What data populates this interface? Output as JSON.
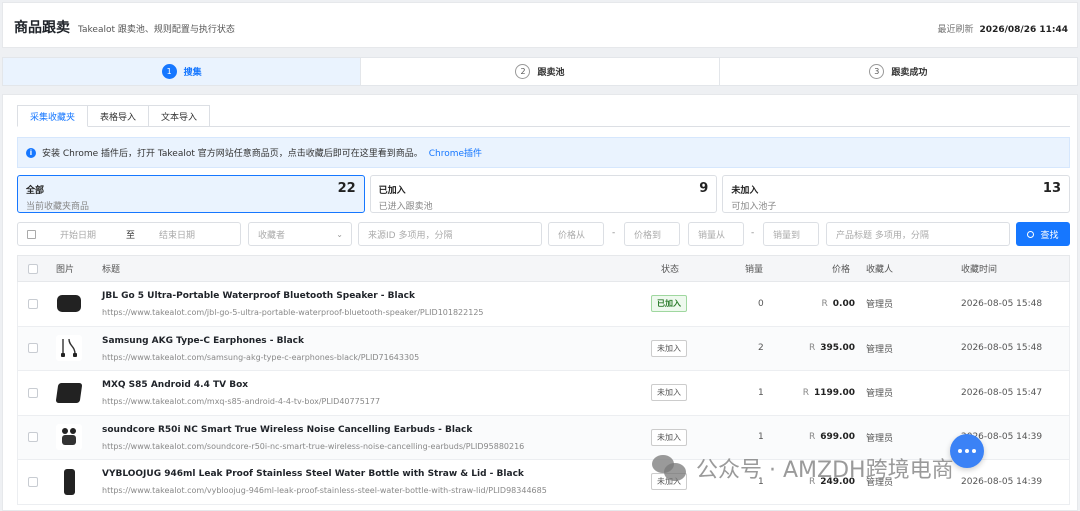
{
  "header": {
    "title": "商品跟卖",
    "subtitle": "Takealot 跟卖池、规则配置与执行状态",
    "refresh_label": "最近刷新",
    "refresh_time": "2026/08/26 11:44"
  },
  "steps": [
    {
      "num": "1",
      "label": "搜集"
    },
    {
      "num": "2",
      "label": "跟卖池"
    },
    {
      "num": "3",
      "label": "跟卖成功"
    }
  ],
  "tabs": [
    "采集收藏夹",
    "表格导入",
    "文本导入"
  ],
  "notice": {
    "text": "安装 Chrome 插件后，打开 Takealot 官方网站任意商品页，点击收藏后即可在这里看到商品。",
    "link": "Chrome插件"
  },
  "stats": [
    {
      "label": "全部",
      "count": "22",
      "desc": "当前收藏夹商品"
    },
    {
      "label": "已加入",
      "count": "9",
      "desc": "已进入跟卖池"
    },
    {
      "label": "未加入",
      "count": "13",
      "desc": "可加入池子"
    }
  ],
  "filters": {
    "start_date": "开始日期",
    "to": "至",
    "end_date": "结束日期",
    "collector": "收藏者",
    "source_id": "来源ID 多项用，分隔",
    "price_from": "价格从",
    "price_to": "价格到",
    "sales_from": "销量从",
    "sales_to": "销量到",
    "dash": "-",
    "product_title": "产品标题 多项用，分隔",
    "search": "查找"
  },
  "table": {
    "headers": {
      "image": "图片",
      "title": "标题",
      "status": "状态",
      "sales": "销量",
      "price": "价格",
      "collector": "收藏人",
      "time": "收藏时间"
    },
    "currency": "R",
    "rows": [
      {
        "title": "JBL Go 5 Ultra-Portable Waterproof Bluetooth Speaker - Black",
        "url": "https://www.takealot.com/jbl-go-5-ultra-portable-waterproof-bluetooth-speaker/PLID101822125",
        "status": "已加入",
        "sales": "0",
        "price": "0.00",
        "collector": "管理员",
        "time": "2026-08-05 15:48"
      },
      {
        "title": "Samsung AKG Type-C Earphones - Black",
        "url": "https://www.takealot.com/samsung-akg-type-c-earphones-black/PLID71643305",
        "status": "未加入",
        "sales": "2",
        "price": "395.00",
        "collector": "管理员",
        "time": "2026-08-05 15:48"
      },
      {
        "title": "MXQ S85 Android 4.4 TV Box",
        "url": "https://www.takealot.com/mxq-s85-android-4-4-tv-box/PLID40775177",
        "status": "未加入",
        "sales": "1",
        "price": "1199.00",
        "collector": "管理员",
        "time": "2026-08-05 15:47"
      },
      {
        "title": "soundcore R50i NC Smart True Wireless Noise Cancelling Earbuds - Black",
        "url": "https://www.takealot.com/soundcore-r50i-nc-smart-true-wireless-noise-cancelling-earbuds/PLID95880216",
        "status": "未加入",
        "sales": "1",
        "price": "699.00",
        "collector": "管理员",
        "time": "2026-08-05 14:39"
      },
      {
        "title": "VYBLOOJUG 946ml Leak Proof Stainless Steel Water Bottle with Straw & Lid - Black",
        "url": "https://www.takealot.com/vybloojug-946ml-leak-proof-stainless-steel-water-bottle-with-straw-lid/PLID98344685",
        "status": "未加入",
        "sales": "1",
        "price": "249.00",
        "collector": "管理员",
        "time": "2026-08-05 14:39"
      }
    ]
  },
  "watermark": "公众号 · AMZDH跨境电商"
}
